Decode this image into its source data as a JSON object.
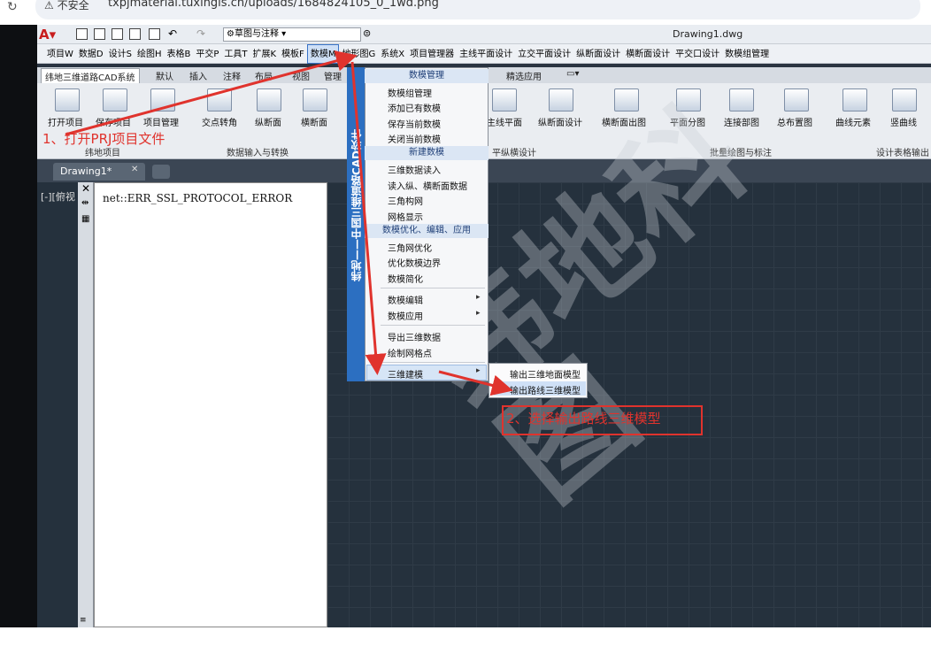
{
  "browser": {
    "security": "不安全",
    "url": "txpjmaterial.tuxingis.cn/uploads/1684824105_0_1wd.png"
  },
  "app": {
    "workspace": "草图与注释",
    "doc_title": "Drawing1.dwg"
  },
  "menubar": [
    "项目W",
    "数据D",
    "设计S",
    "绘图H",
    "表格B",
    "平交P",
    "工具T",
    "扩展K",
    "模板F",
    "数模M",
    "地形图G",
    "系统X",
    "项目管理器",
    "主线平面设计",
    "立交平面设计",
    "纵断面设计",
    "横断面设计",
    "平交口设计",
    "数模组管理"
  ],
  "ribbon_tabs": [
    "纬地三维道路CAD系统",
    "默认",
    "插入",
    "注释",
    "布局",
    "视图",
    "管理",
    "精选应用"
  ],
  "ribbon_buttons": [
    "打开项目",
    "保存项目",
    "项目管理",
    "交点转角",
    "纵断面",
    "横断面",
    "主线平面",
    "纵断面设计",
    "横断面出图",
    "平面分图",
    "连接部图",
    "总布置图",
    "曲线元素",
    "竖曲线"
  ],
  "ribbon_panels": [
    "纬地项目",
    "数据输入与转换",
    "平纵横设计",
    "批量绘图与标注",
    "设计表格输出"
  ],
  "file_tab": "Drawing1*",
  "viewport_label": "[-][俯视",
  "palette_error": "net::ERR_SSL_PROTOCOL_ERROR",
  "vertical_brand": "纬地——中国三维道路CAD软件",
  "menu": {
    "h1": "数模管理",
    "g1": [
      "数模组管理",
      "添加已有数模",
      "保存当前数模",
      "关闭当前数模"
    ],
    "h2": "新建数模",
    "g2": [
      "三维数据读入",
      "读入纵、横断面数据",
      "三角构网",
      "网格显示"
    ],
    "h3": "数模优化、编辑、应用",
    "g3": [
      "三角网优化",
      "优化数模边界",
      "数模简化"
    ],
    "g4": [
      "数模编辑",
      "数模应用"
    ],
    "g5": [
      "导出三维数据",
      "绘制网格点"
    ],
    "g6": "三维建模"
  },
  "submenu": [
    "输出三维地面模型",
    "输出路线三维模型"
  ],
  "annotations": {
    "step1": "1、打开PRJ项目文件",
    "step2": "2、选择输出路线三维模型"
  },
  "colors": {
    "annotation": "#e0332d",
    "menu_brand": "#2c6fc1",
    "canvas": "#25313d"
  }
}
